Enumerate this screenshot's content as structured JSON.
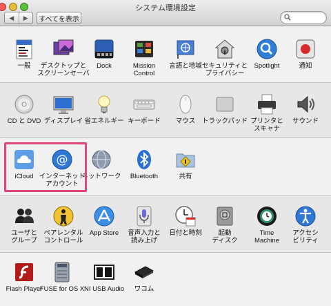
{
  "window": {
    "title": "システム環境設定",
    "back_glyph": "◀",
    "forward_glyph": "▶",
    "show_all": "すべてを表示"
  },
  "accent_colors": {
    "highlight": "#e0457b"
  },
  "sections": [
    {
      "items": [
        {
          "id": "general",
          "label": "一般",
          "icon": "general-file-icon"
        },
        {
          "id": "desktop",
          "label": "デスクトップと\nスクリーンセーバ",
          "icon": "desktop-screensaver-icon"
        },
        {
          "id": "dock",
          "label": "Dock",
          "icon": "dock-icon"
        },
        {
          "id": "mission",
          "label": "Mission\nControl",
          "icon": "mission-control-icon"
        },
        {
          "id": "language",
          "label": "言語と地域",
          "icon": "language-globe-flag-icon"
        },
        {
          "id": "security",
          "label": "セキュリティと\nプライバシー",
          "icon": "security-house-icon"
        },
        {
          "id": "spotlight",
          "label": "Spotlight",
          "icon": "spotlight-magnifier-icon"
        },
        {
          "id": "notifications",
          "label": "通知",
          "icon": "notifications-icon"
        }
      ]
    },
    {
      "items": [
        {
          "id": "cddvd",
          "label": "CD と DVD",
          "icon": "cd-dvd-icon"
        },
        {
          "id": "displays",
          "label": "ディスプレイ",
          "icon": "display-icon"
        },
        {
          "id": "energy",
          "label": "省エネルギー",
          "icon": "energy-bulb-icon"
        },
        {
          "id": "keyboard",
          "label": "キーボード",
          "icon": "keyboard-icon"
        },
        {
          "id": "mouse",
          "label": "マウス",
          "icon": "mouse-icon"
        },
        {
          "id": "trackpad",
          "label": "トラックパッド",
          "icon": "trackpad-icon"
        },
        {
          "id": "printers",
          "label": "プリンタと\nスキャナ",
          "icon": "printer-icon"
        },
        {
          "id": "sound",
          "label": "サウンド",
          "icon": "sound-speaker-icon"
        }
      ]
    },
    {
      "items": [
        {
          "id": "icloud",
          "label": "iCloud",
          "icon": "icloud-icon"
        },
        {
          "id": "internet",
          "label": "インターネット\nアカウント",
          "icon": "internet-accounts-at-icon"
        },
        {
          "id": "network",
          "label": "ネットワーク",
          "icon": "network-globe-icon"
        },
        {
          "id": "bluetooth",
          "label": "Bluetooth",
          "icon": "bluetooth-icon"
        },
        {
          "id": "sharing",
          "label": "共有",
          "icon": "sharing-folder-icon"
        }
      ]
    },
    {
      "items": [
        {
          "id": "users",
          "label": "ユーザと\nグループ",
          "icon": "users-groups-icon"
        },
        {
          "id": "parental",
          "label": "ペアレンタル\nコントロール",
          "icon": "parental-controls-icon"
        },
        {
          "id": "appstore",
          "label": "App Store",
          "icon": "app-store-icon"
        },
        {
          "id": "dictation",
          "label": "音声入力と\n読み上げ",
          "icon": "dictation-microphone-icon"
        },
        {
          "id": "datetime",
          "label": "日付と時刻",
          "icon": "date-time-clock-icon"
        },
        {
          "id": "startup",
          "label": "起動\nディスク",
          "icon": "startup-disk-icon"
        },
        {
          "id": "timemachine",
          "label": "Time\nMachine",
          "icon": "time-machine-icon"
        },
        {
          "id": "accessibility",
          "label": "アクセシ\nビリティ",
          "icon": "accessibility-icon"
        }
      ]
    },
    {
      "items": [
        {
          "id": "flash",
          "label": "Flash Player",
          "icon": "flash-player-icon"
        },
        {
          "id": "fuse",
          "label": "FUSE for OS X",
          "icon": "fuse-icon"
        },
        {
          "id": "niusb",
          "label": "NI USB Audio",
          "icon": "ni-usb-audio-icon"
        },
        {
          "id": "wacom",
          "label": "ワコム",
          "icon": "wacom-tablet-icon"
        }
      ]
    }
  ]
}
